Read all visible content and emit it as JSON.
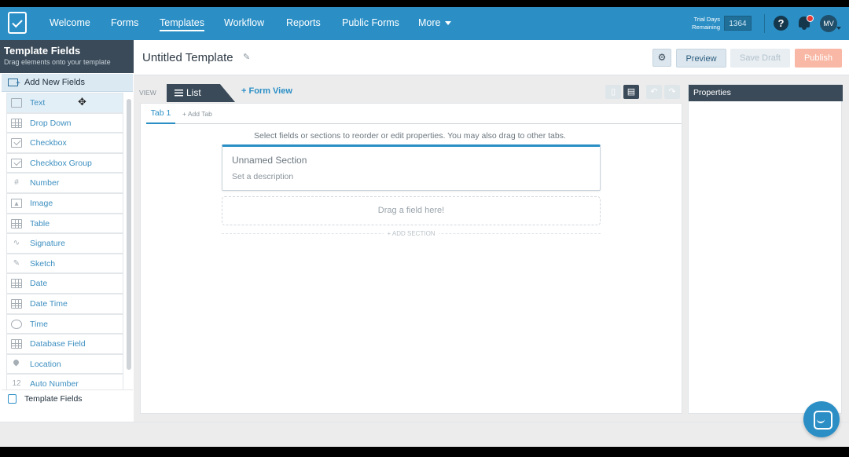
{
  "nav": {
    "items": [
      "Welcome",
      "Forms",
      "Templates",
      "Workflow",
      "Reports",
      "Public Forms",
      "More"
    ],
    "active": "Templates",
    "trial_label": "Trial Days Remaining",
    "trial_count": "1364",
    "avatar_initials": "MV",
    "icons": [
      "logo-icon",
      "help-icon",
      "bell-icon",
      "avatar"
    ]
  },
  "sidebar": {
    "title": "Template Fields",
    "subtitle": "Drag elements onto your template",
    "add_new_label": "Add New Fields",
    "fields": [
      {
        "label": "Text",
        "icon": "text-field-icon"
      },
      {
        "label": "Drop Down",
        "icon": "dropdown-icon"
      },
      {
        "label": "Checkbox",
        "icon": "checkbox-icon"
      },
      {
        "label": "Checkbox Group",
        "icon": "checkbox-group-icon"
      },
      {
        "label": "Number",
        "icon": "hash-icon"
      },
      {
        "label": "Image",
        "icon": "image-icon"
      },
      {
        "label": "Table",
        "icon": "table-icon"
      },
      {
        "label": "Signature",
        "icon": "signature-icon"
      },
      {
        "label": "Sketch",
        "icon": "pencil-icon"
      },
      {
        "label": "Date",
        "icon": "calendar-icon"
      },
      {
        "label": "Date Time",
        "icon": "calendar-clock-icon"
      },
      {
        "label": "Time",
        "icon": "clock-icon"
      },
      {
        "label": "Database Field",
        "icon": "database-icon"
      },
      {
        "label": "Location",
        "icon": "location-pin-icon"
      },
      {
        "label": "Auto Number",
        "icon": "auto-number-icon"
      }
    ],
    "footer_label": "Template Fields"
  },
  "header": {
    "template_title": "Untitled Template",
    "preview_label": "Preview",
    "save_draft_label": "Save Draft",
    "publish_label": "Publish"
  },
  "canvas": {
    "view_label": "VIEW",
    "list_label": "List",
    "form_view_label": "+ Form View",
    "tab1_label": "Tab 1",
    "add_tab_label": "+ Add Tab",
    "hint": "Select fields or sections to reorder or edit properties. You may also drag to other tabs.",
    "section_name": "Unnamed Section",
    "section_desc": "Set a description",
    "drop_text": "Drag a field here!",
    "add_section_label": "+ ADD SECTION"
  },
  "properties": {
    "title": "Properties"
  },
  "colors": {
    "nav_blue": "#2b8fc6",
    "dark_slate": "#3a4a58",
    "publish_salmon": "#f9b8a5"
  }
}
